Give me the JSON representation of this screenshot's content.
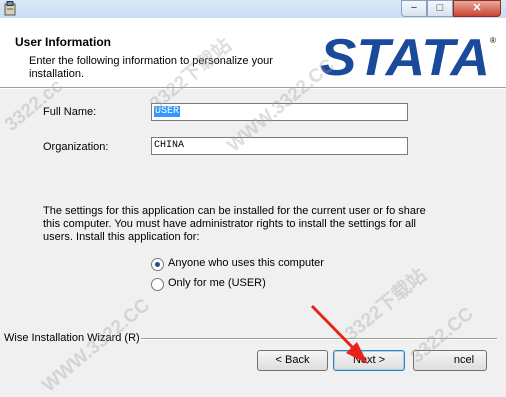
{
  "window": {
    "minimize_glyph": "−",
    "maximize_glyph": "□",
    "close_glyph": "✕"
  },
  "header": {
    "title": "User Information",
    "description": "Enter the following information to personalize your installation.",
    "logo_text": "STATA",
    "logo_color": "#1a4a9a"
  },
  "form": {
    "full_name_label": "Full Name:",
    "full_name_value": "USER",
    "organization_label": "Organization:",
    "organization_value": "CHINA"
  },
  "info_text": "The settings for this application can be installed for the current user or fo share this computer. You must have administrator rights to install the settings for all users. Install this application for:",
  "options": [
    {
      "label": "Anyone who uses this computer",
      "selected": true
    },
    {
      "label": "Only for me (USER)",
      "selected": false
    }
  ],
  "footer": {
    "wizard_label": "Wise Installation Wizard (R)",
    "back_label": "< Back",
    "next_label": "Next >",
    "cancel_label": "ncel"
  },
  "watermarks": [
    "3322.cc",
    "3322下载站",
    "WWW.3322.CC",
    "3322下载站",
    "WWW.3322.CC",
    "3322.CC"
  ]
}
